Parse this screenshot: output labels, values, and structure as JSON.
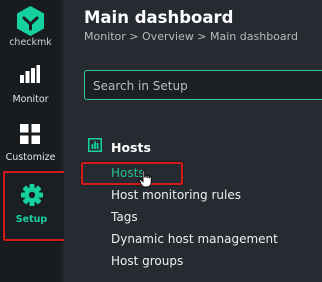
{
  "brand": {
    "logo_text": "checkmk",
    "accent_color": "#15d1a0"
  },
  "sidebar": {
    "items": [
      {
        "label": "Monitor",
        "icon": "bar-chart-icon",
        "active": false
      },
      {
        "label": "Customize",
        "icon": "grid-icon",
        "active": false
      },
      {
        "label": "Setup",
        "icon": "gear-icon",
        "active": true
      }
    ]
  },
  "header": {
    "title": "Main dashboard",
    "breadcrumb": "Monitor > Overview > Main dashboard"
  },
  "search": {
    "placeholder": "Search in Setup",
    "value": ""
  },
  "section": {
    "title": "Hosts",
    "icon": "hosts-section-icon",
    "items": [
      {
        "label": "Hosts"
      },
      {
        "label": "Host monitoring rules"
      },
      {
        "label": "Tags"
      },
      {
        "label": "Dynamic host management"
      },
      {
        "label": "Host groups"
      }
    ]
  },
  "highlight_color": "#d11a1a"
}
